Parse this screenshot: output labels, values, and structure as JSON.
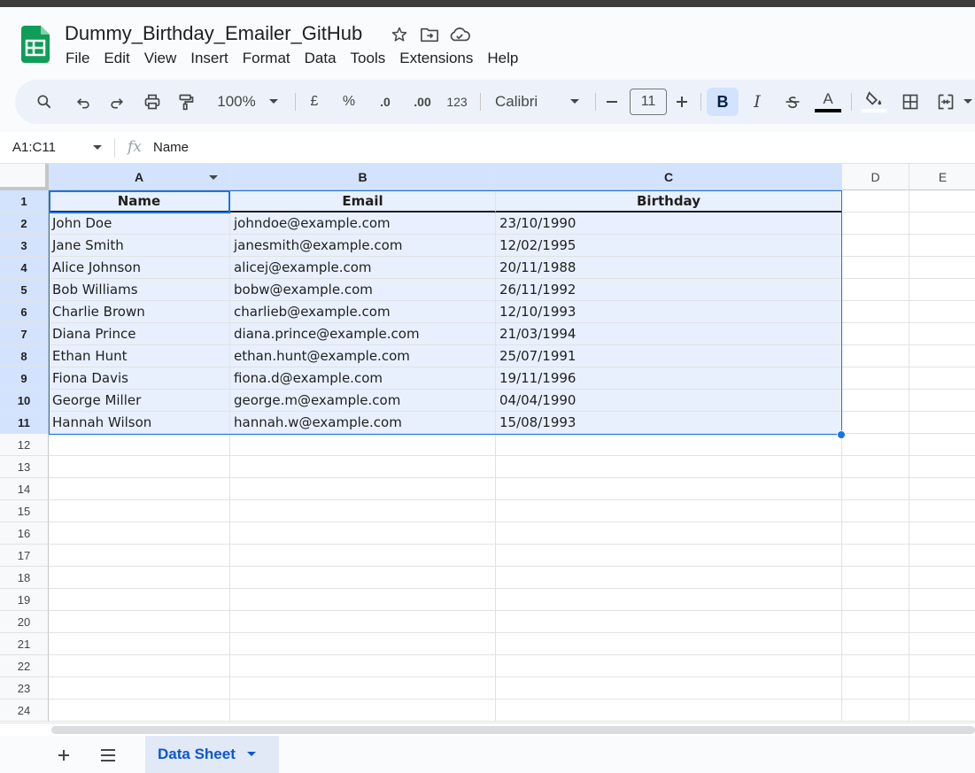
{
  "app": {
    "doc_title": "Dummy_Birthday_Emailer_GitHub",
    "brand_green": "#0f9d58"
  },
  "menu": [
    "File",
    "Edit",
    "View",
    "Insert",
    "Format",
    "Data",
    "Tools",
    "Extensions",
    "Help"
  ],
  "toolbar": {
    "zoom": "100%",
    "currency": "£",
    "percent": "%",
    "dec_decrease": ".0",
    "dec_increase": ".00",
    "number_format": "123",
    "font": "Calibri",
    "font_size": "11",
    "bold": "B",
    "italic": "I",
    "text_color": "A"
  },
  "formula_bar": {
    "name_box": "A1:C11",
    "fx": "fx",
    "content": "Name"
  },
  "columns": [
    "A",
    "B",
    "C",
    "D",
    "E"
  ],
  "rows": [
    "1",
    "2",
    "3",
    "4",
    "5",
    "6",
    "7",
    "8",
    "9",
    "10",
    "11",
    "12",
    "13",
    "14",
    "15",
    "16",
    "17",
    "18",
    "19",
    "20",
    "21",
    "22",
    "23",
    "24"
  ],
  "table": {
    "headers": [
      "Name",
      "Email",
      "Birthday"
    ],
    "data": [
      [
        "John Doe",
        "johndoe@example.com",
        "23/10/1990"
      ],
      [
        "Jane Smith",
        "janesmith@example.com",
        "12/02/1995"
      ],
      [
        "Alice Johnson",
        "alicej@example.com",
        "20/11/1988"
      ],
      [
        "Bob Williams",
        "bobw@example.com",
        "26/11/1992"
      ],
      [
        "Charlie Brown",
        "charlieb@example.com",
        "12/10/1993"
      ],
      [
        "Diana Prince",
        "diana.prince@example.com",
        "21/03/1994"
      ],
      [
        "Ethan Hunt",
        "ethan.hunt@example.com",
        "25/07/1991"
      ],
      [
        "Fiona Davis",
        "fiona.d@example.com",
        "19/11/1996"
      ],
      [
        "George Miller",
        "george.m@example.com",
        "04/04/1990"
      ],
      [
        "Hannah Wilson",
        "hannah.w@example.com",
        "15/08/1993"
      ]
    ]
  },
  "sheets": [
    {
      "name": "Data Sheet",
      "active": true
    }
  ]
}
